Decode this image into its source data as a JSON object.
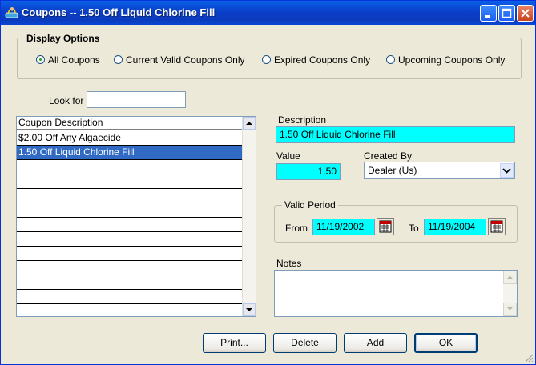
{
  "window": {
    "title": "Coupons -- 1.50 Off Liquid Chlorine Fill"
  },
  "display_options": {
    "label": "Display Options",
    "options": [
      {
        "label": "All Coupons",
        "checked": true
      },
      {
        "label": "Current Valid Coupons Only",
        "checked": false
      },
      {
        "label": "Expired Coupons Only",
        "checked": false
      },
      {
        "label": "Upcoming Coupons Only",
        "checked": false
      }
    ]
  },
  "look_for": {
    "label": "Look for",
    "value": ""
  },
  "list": {
    "header": "Coupon Description",
    "rows": [
      "$2.00 Off Any Algaecide",
      "1.50 Off Liquid Chlorine Fill",
      "",
      "",
      "",
      "",
      "",
      "",
      "",
      "",
      "",
      "",
      ""
    ],
    "selected_index": 1
  },
  "detail": {
    "description_label": "Description",
    "description_value": "1.50 Off Liquid Chlorine Fill",
    "value_label": "Value",
    "value": "1.50",
    "created_by_label": "Created By",
    "created_by_value": "Dealer (Us)",
    "valid_period_label": "Valid Period",
    "from_label": "From",
    "from_value": "11/19/2002",
    "to_label": "To",
    "to_value": "11/19/2004",
    "notes_label": "Notes",
    "notes_value": ""
  },
  "buttons": {
    "print": "Print...",
    "delete": "Delete",
    "add": "Add",
    "ok": "OK"
  },
  "colors": {
    "title_bar": "#0a3fc9",
    "highlight": "#00ffff",
    "selection": "#316ac5",
    "dialog_bg": "#ece9d8"
  }
}
